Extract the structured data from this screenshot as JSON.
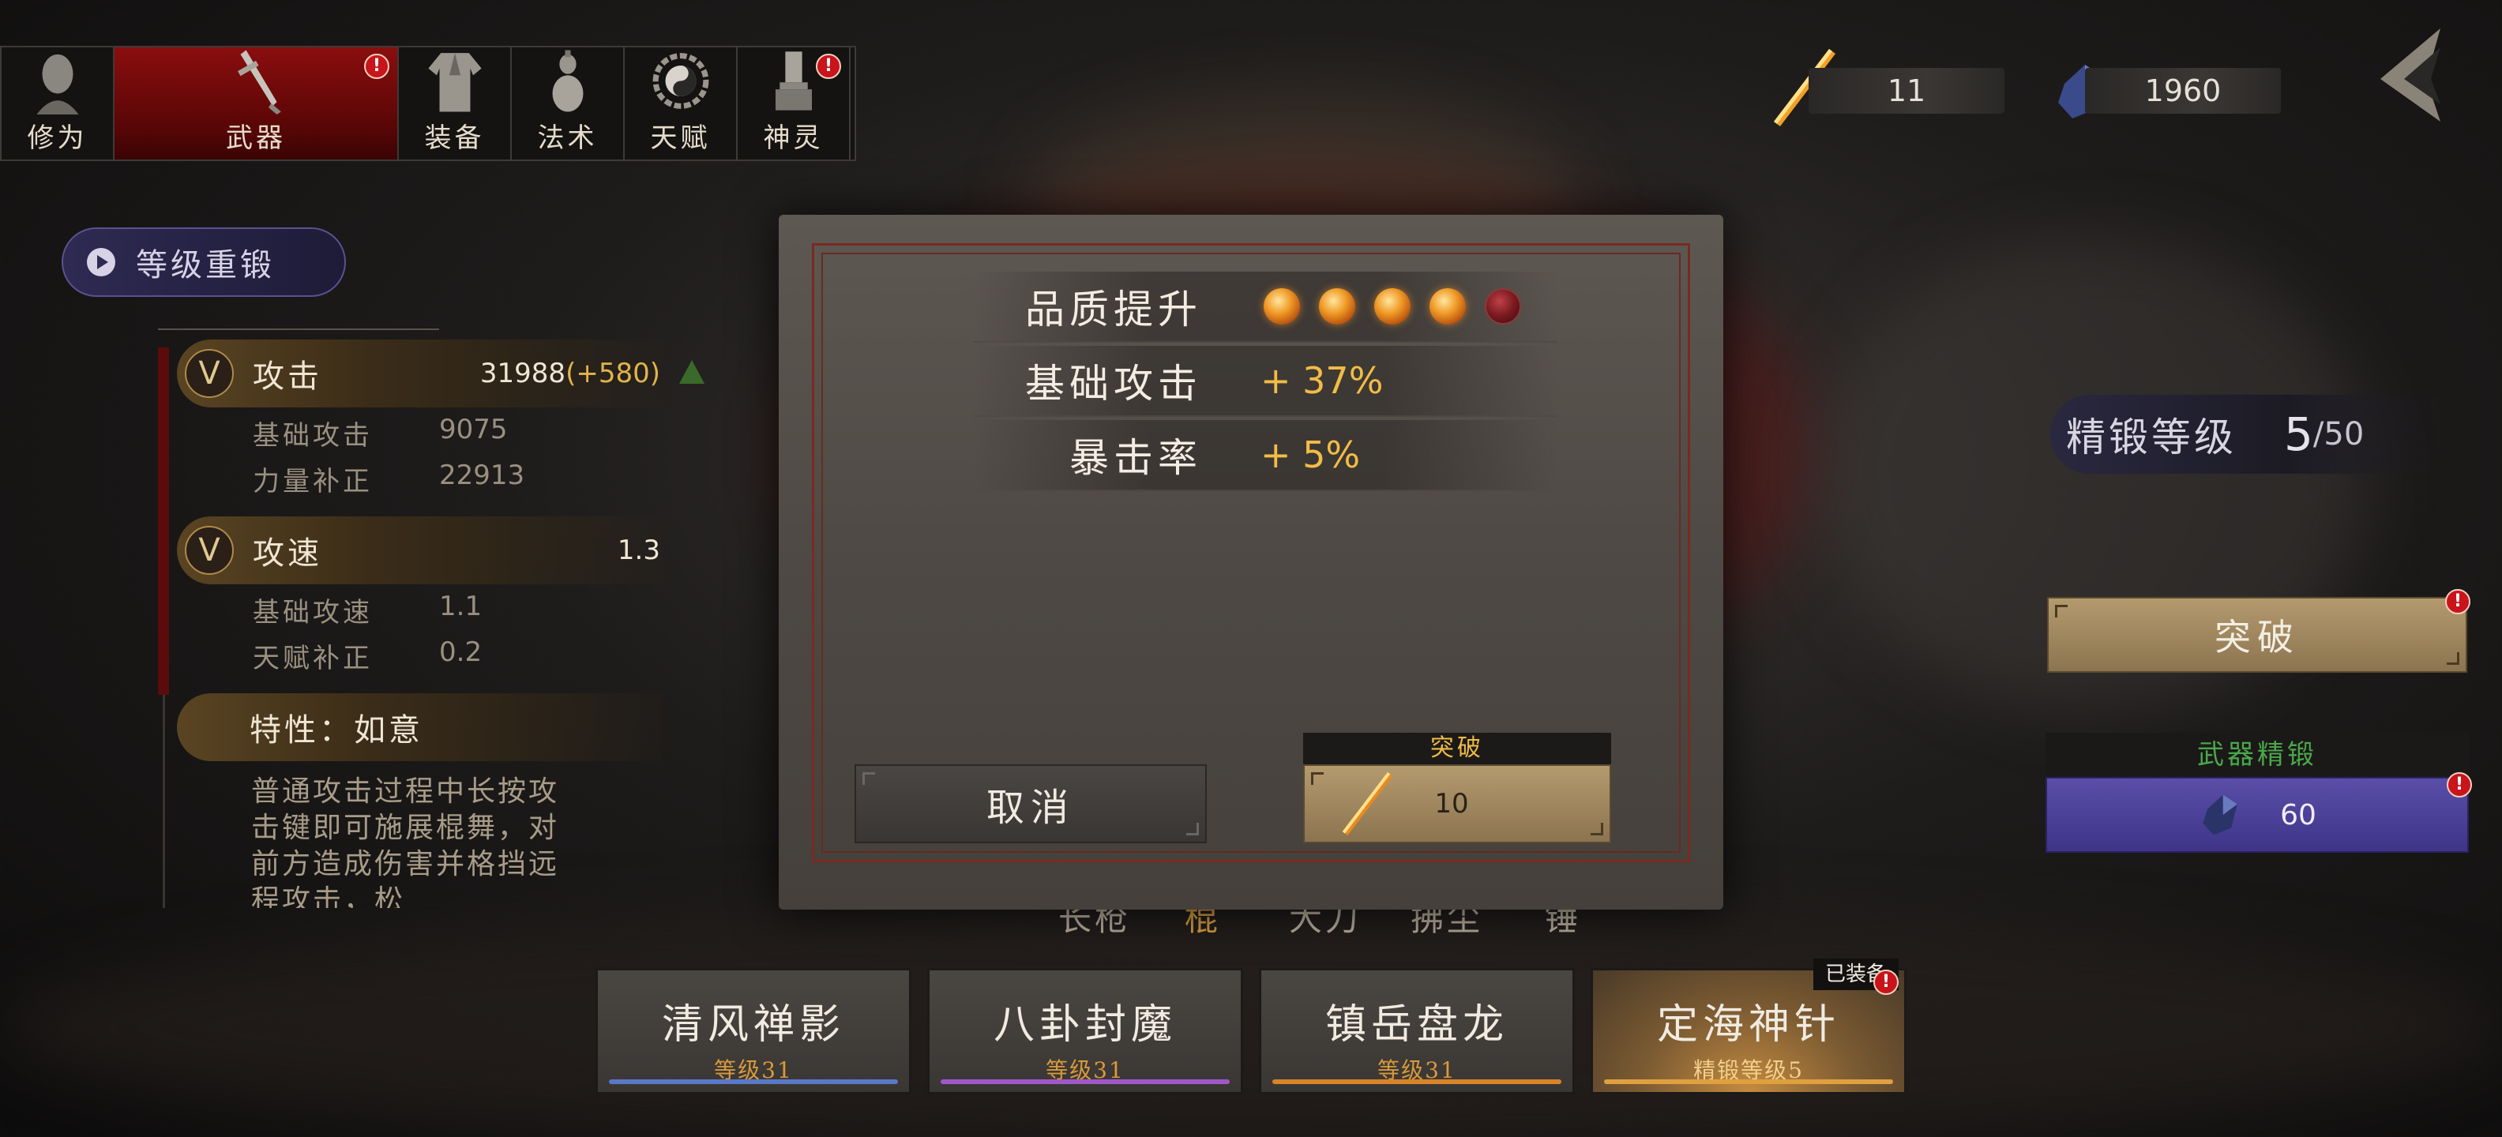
{
  "tabs": [
    {
      "label": "修为",
      "icon": "face-icon"
    },
    {
      "label": "武器",
      "icon": "sword-icon",
      "alert": "!"
    },
    {
      "label": "装备",
      "icon": "robe-icon"
    },
    {
      "label": "法术",
      "icon": "gourd-icon"
    },
    {
      "label": "天赋",
      "icon": "bagua-icon"
    },
    {
      "label": "神灵",
      "icon": "shrine-icon",
      "alert": "!"
    }
  ],
  "currency": {
    "spark": {
      "value": "11",
      "icon": "golden-staff-icon"
    },
    "crystal": {
      "value": "1960",
      "icon": "blue-crystal-icon"
    }
  },
  "left_panel": {
    "reforge_label": "等级重锻",
    "attack": {
      "name": "攻击",
      "value": "31988",
      "bonus": "(+580)",
      "rows": [
        {
          "label": "基础攻击",
          "value": "9075"
        },
        {
          "label": "力量补正",
          "value": "22913"
        }
      ]
    },
    "speed": {
      "name": "攻速",
      "value": "1.3",
      "rows": [
        {
          "label": "基础攻速",
          "value": "1.1"
        },
        {
          "label": "天赋补正",
          "value": "0.2"
        }
      ]
    },
    "trait": {
      "name": "特性：如意",
      "description": "普通攻击过程中长按攻击键即可施展棍舞，对前方造成伤害并格挡远程攻击，松"
    }
  },
  "dialog": {
    "quality_label": "品质提升",
    "quality_orbs": {
      "lit": 4,
      "total": 5
    },
    "base_attack_label": "基础攻击",
    "base_attack_value": "+ 37%",
    "crit_label": "暴击率",
    "crit_value": "+ 5%",
    "cancel_label": "取消",
    "break_title": "突破",
    "break_cost": "10"
  },
  "right_panel": {
    "refine_label": "精锻等级",
    "refine_level": "5",
    "refine_max": "/50",
    "breakthrough_label": "突破",
    "weapon_refine_label": "武器精锻",
    "weapon_refine_cost": "60",
    "alert": "!"
  },
  "category_row": [
    "长枪",
    "棍",
    "大刀",
    "拂尘",
    "锤"
  ],
  "weapons": [
    {
      "name": "清风禅影",
      "level": "等级31",
      "bar_color": "#5a78c8"
    },
    {
      "name": "八卦封魔",
      "level": "等级31",
      "bar_color": "#a058c8"
    },
    {
      "name": "镇岳盘龙",
      "level": "等级31",
      "bar_color": "#d8842a"
    },
    {
      "name": "定海神针",
      "level": "精锻等级5",
      "bar_color": "#e0a040",
      "equipped_tag": "已装备"
    }
  ],
  "colors": {
    "accent_gold": "#f2bc46",
    "tab_active": "#8a0e0e",
    "refine_purple": "#4a3e96",
    "alert_red": "#c8141a"
  }
}
